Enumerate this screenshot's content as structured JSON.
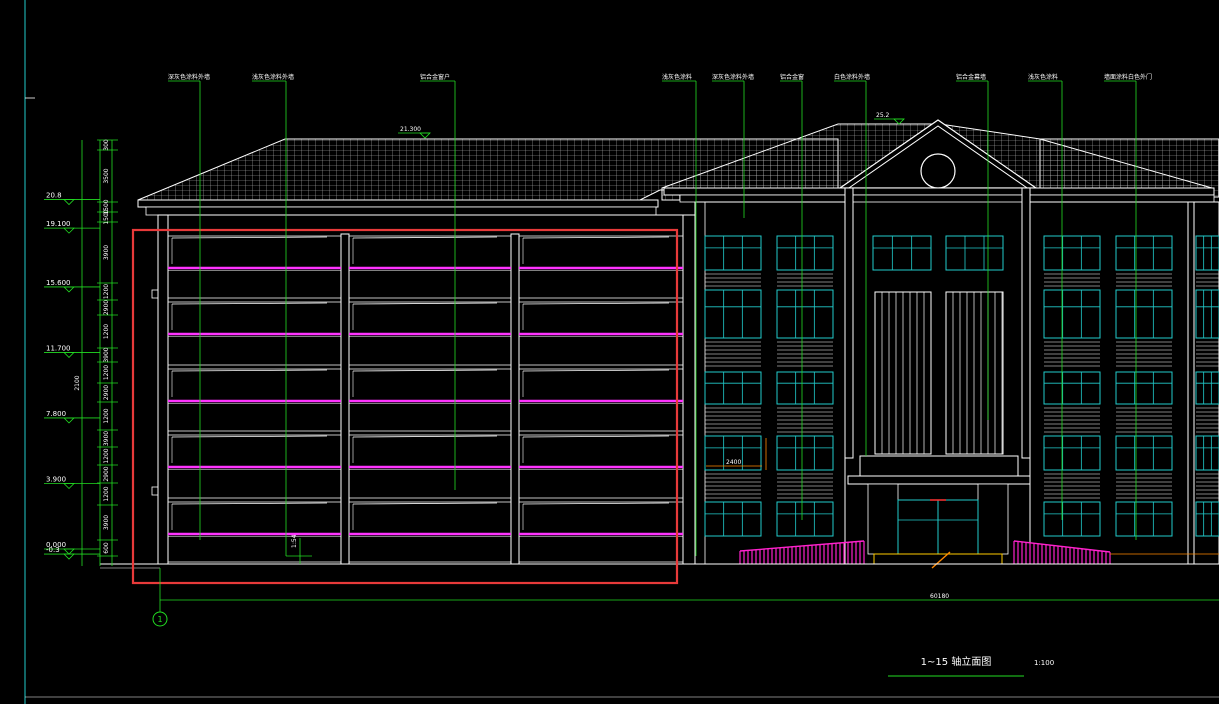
{
  "drawing": {
    "title": "1~15 轴立面图",
    "scale": "1:100",
    "total_width_dim": "60180",
    "axis_label": "1",
    "ridge_level": "25.2",
    "eave_level": "21.300"
  },
  "levels": [
    {
      "label": "20.8",
      "elev": 20.8
    },
    {
      "label": "19.100",
      "elev": 19.1
    },
    {
      "label": "15.600",
      "elev": 15.6
    },
    {
      "label": "11.700",
      "elev": 11.7
    },
    {
      "label": "7.800",
      "elev": 7.8
    },
    {
      "label": "3.900",
      "elev": 3.9
    },
    {
      "label": "0.000",
      "elev": 0.0
    },
    {
      "label": "-0.3",
      "elev": -0.3
    }
  ],
  "dims": {
    "overall": "2100",
    "segments": [
      "300",
      "3500",
      "1500",
      "1500",
      "3900",
      "1200",
      "2900",
      "1200",
      "3900",
      "1200",
      "2900",
      "1200",
      "3900",
      "1200",
      "2900",
      "1200",
      "3900",
      "600"
    ]
  },
  "callouts": [
    {
      "text": "深灰色涂料外墙"
    },
    {
      "text": "浅灰色涂料外墙"
    },
    {
      "text": "铝合金窗户"
    },
    {
      "text": "浅灰色涂料"
    },
    {
      "text": "深灰色涂料外墙"
    },
    {
      "text": "铝合金窗"
    },
    {
      "text": "白色涂料外墙"
    },
    {
      "text": "铝合金幕墙"
    },
    {
      "text": "浅灰色涂料"
    },
    {
      "text": "墙面涂料白色外门"
    }
  ],
  "small_dims": {
    "step": "1:54",
    "canopy": "2400"
  },
  "colors": {
    "line": "#ffffff",
    "leader": "#22dd22",
    "glass": "#22cccc",
    "slab": "#ff33ff",
    "highlight": "#e83a3a",
    "ramp": "#ff22cc",
    "accent": "#ff8800"
  }
}
